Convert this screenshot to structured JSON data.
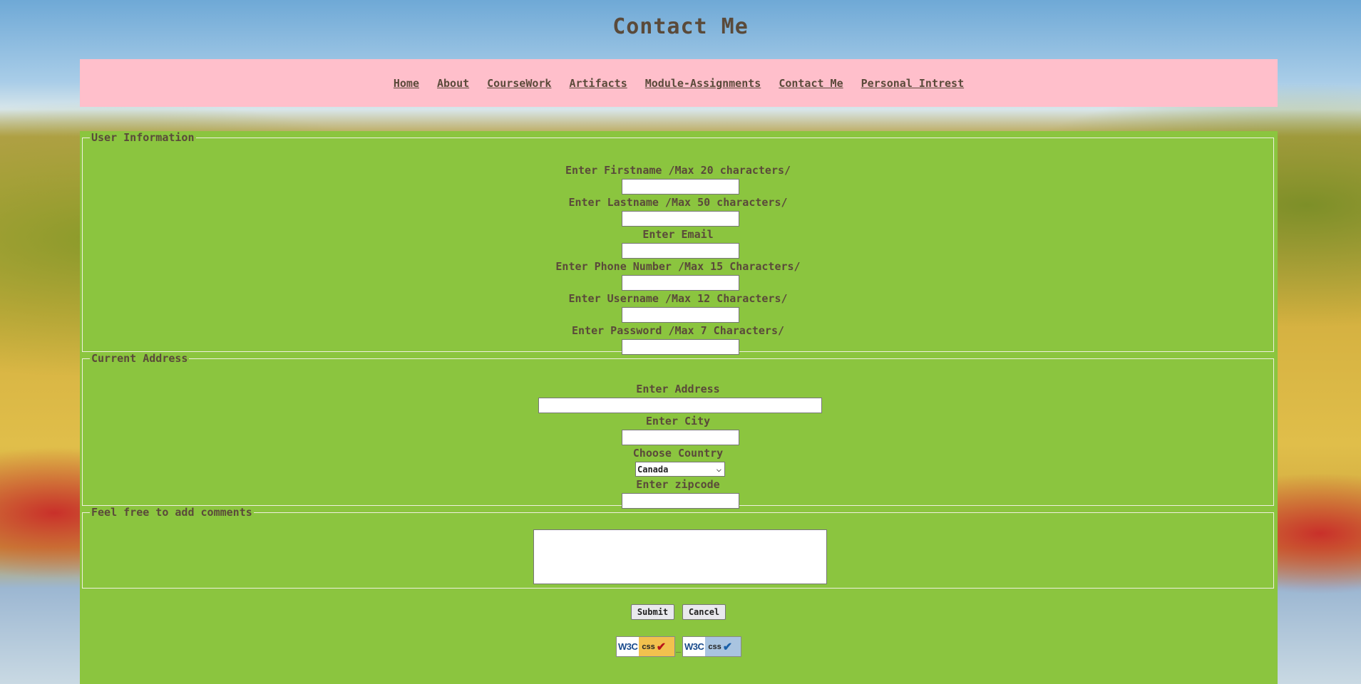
{
  "page": {
    "title": "Contact Me"
  },
  "nav": {
    "items": [
      {
        "label": "Home"
      },
      {
        "label": "About"
      },
      {
        "label": "CourseWork"
      },
      {
        "label": "Artifacts"
      },
      {
        "label": "Module-Assignments"
      },
      {
        "label": "Contact Me"
      },
      {
        "label": "Personal Intrest"
      }
    ]
  },
  "user_info": {
    "legend": "User Information",
    "firstname_label": "Enter Firstname /Max 20 characters/",
    "lastname_label": "Enter Lastname /Max 50 characters/",
    "email_label": "Enter Email",
    "phone_label": "Enter Phone Number /Max 15 Characters/",
    "username_label": "Enter Username /Max 12 Characters/",
    "password_label": "Enter Password /Max 7 Characters/"
  },
  "address": {
    "legend": "Current Address",
    "address_label": "Enter Address",
    "city_label": "Enter City",
    "country_label": "Choose Country",
    "country_selected": "Canada",
    "zipcode_label": "Enter zipcode"
  },
  "comments": {
    "legend": "Feel free to add comments"
  },
  "actions": {
    "submit_label": "Submit",
    "cancel_label": "Cancel"
  },
  "badges": {
    "badge1": {
      "w3c": "W3C",
      "css": "css",
      "tick_color": "#b8141a",
      "bg": "#f2c14e"
    },
    "badge2": {
      "w3c": "W3C",
      "css": "css",
      "tick_color": "#1a5fa8",
      "bg": "#a9c4e0"
    },
    "separator": "_"
  },
  "colors": {
    "nav_bg": "#ffbfcb",
    "content_bg": "#8bc53f",
    "text": "#5a4a3a"
  }
}
